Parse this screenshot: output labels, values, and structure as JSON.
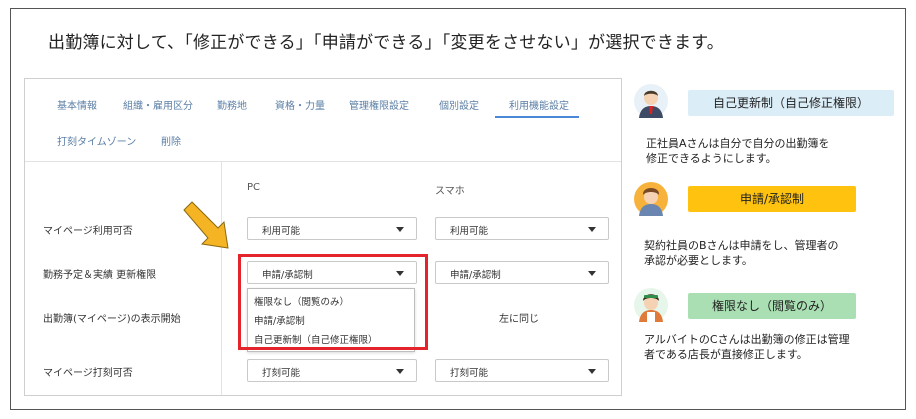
{
  "headline": "出勤簿に対して、「修正ができる」「申請ができる」「変更をさせない」が選択できます。",
  "settings": {
    "tabs": [
      {
        "label": "基本情報"
      },
      {
        "label": "組織・雇用区分"
      },
      {
        "label": "勤務地"
      },
      {
        "label": "資格・力量"
      },
      {
        "label": "管理権限設定"
      },
      {
        "label": "個別設定"
      },
      {
        "label": "利用機能設定",
        "active": true
      },
      {
        "label": "打刻タイムゾーン"
      },
      {
        "label": "削除"
      }
    ],
    "columns": {
      "pc": "PC",
      "mobile": "スマホ"
    },
    "rows": [
      {
        "label": "マイページ利用可否",
        "pc": "利用可能",
        "mobile": "利用可能"
      },
      {
        "label": "勤務予定＆実績 更新権限",
        "pc": "申請/承認制",
        "mobile": "申請/承認制"
      },
      {
        "label": "出勤簿(マイページ)の表示開始",
        "mobile": "左に同じ"
      },
      {
        "label": "マイページ打刻可否",
        "pc": "打刻可能",
        "mobile": "打刻可能"
      }
    ],
    "dropdown_options": [
      "権限なし（閲覧のみ）",
      "申請/承認制",
      "自己更新制（自己修正権限）"
    ]
  },
  "personas": [
    {
      "badge": "自己更新制（自己修正権限）",
      "badge_color": "#dbeef8",
      "description_1": "正社員Aさんは自分で自分の出勤簿を",
      "description_2": "修正できるようにします。",
      "avatar_icon": "businessman-avatar-icon"
    },
    {
      "badge": "申請/承認制",
      "badge_color": "#ffc20e",
      "description_1": "契約社員のBさんは申請をし、管理者の",
      "description_2": "承認が必要とします。",
      "avatar_icon": "worker-avatar-icon"
    },
    {
      "badge": "権限なし（閲覧のみ）",
      "badge_color": "#a9dfb2",
      "description_1": "アルバイトのCさんは出勤簿の修正は管理",
      "description_2": "者である店長が直接修正します。",
      "avatar_icon": "parttimer-avatar-icon"
    }
  ],
  "colors": {
    "highlight": "#e3242b",
    "arrow": "#f5b423",
    "tab_text": "#5b7fa6",
    "tab_active_underline": "#4a88d6"
  }
}
